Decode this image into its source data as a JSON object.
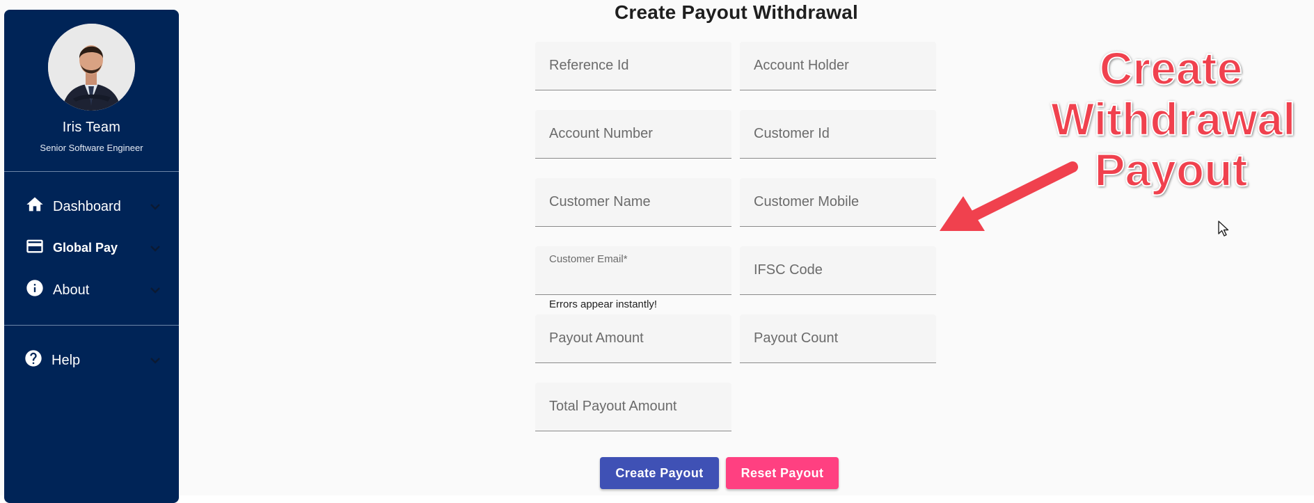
{
  "profile": {
    "name": "Iris Team",
    "role": "Senior Software Engineer"
  },
  "sidebar": {
    "items": [
      {
        "label": "Dashboard",
        "icon": "home-icon"
      },
      {
        "label": "Global Pay",
        "icon": "credit-card-icon"
      },
      {
        "label": "About",
        "icon": "info-icon"
      },
      {
        "label": "Help",
        "icon": "help-icon"
      }
    ]
  },
  "form": {
    "title": "Create Payout Withdrawal",
    "fields": {
      "reference_id": "Reference Id",
      "account_holder": "Account Holder",
      "account_number": "Account Number",
      "customer_id": "Customer Id",
      "customer_name": "Customer Name",
      "customer_mobile": "Customer Mobile",
      "customer_email": "Customer Email*",
      "ifsc_code": "IFSC Code",
      "payout_amount": "Payout Amount",
      "payout_count": "Payout Count",
      "total_payout_amount": "Total Payout Amount"
    },
    "email_hint": "Errors appear instantly!",
    "create_label": "Create Payout",
    "reset_label": "Reset Payout"
  },
  "annotation": {
    "line1": "Create",
    "line2": "Withdrawal",
    "line3": "Payout"
  },
  "colors": {
    "sidebar_bg": "#002457",
    "primary": "#3f51b5",
    "accent": "#ff4081",
    "annotation": "#f0414e"
  }
}
